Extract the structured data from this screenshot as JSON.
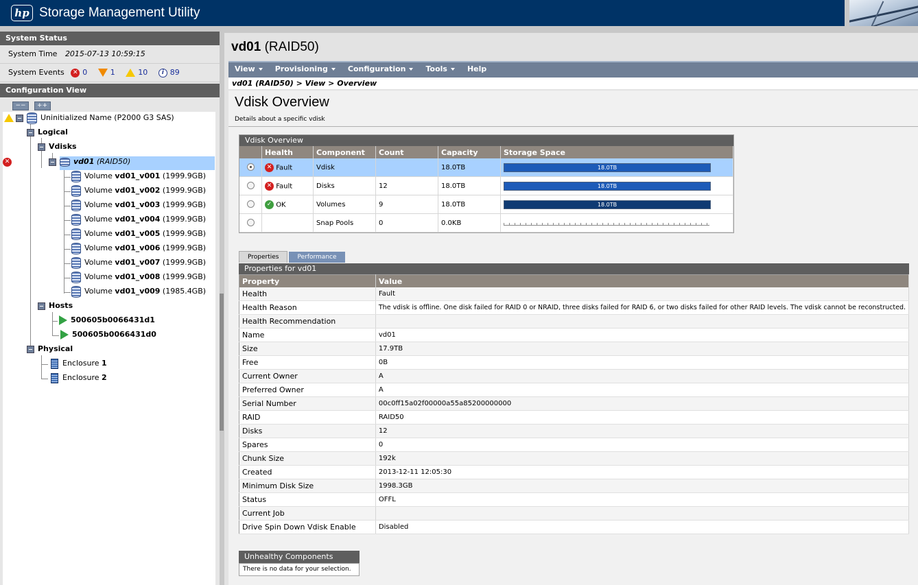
{
  "app": {
    "title": "Storage Management Utility",
    "logo": "hp"
  },
  "left": {
    "system_status_title": "System Status",
    "system_time_label": "System Time",
    "system_time_value": "2015-07-13 10:59:15",
    "system_events_label": "System Events",
    "events": {
      "critical": "0",
      "error": "1",
      "warning": "10",
      "info": "89"
    },
    "config_view_title": "Configuration View",
    "collapse_label": "−−",
    "expand_label": "++",
    "tree": {
      "root": "Uninitialized Name (P2000 G3 SAS)",
      "logical": "Logical",
      "vdisks": "Vdisks",
      "vdisk_name": "vd01",
      "vdisk_raid": "(RAID50)",
      "volume_prefix": "Volume",
      "volumes": [
        {
          "name": "vd01_v001",
          "size": "(1999.9GB)"
        },
        {
          "name": "vd01_v002",
          "size": "(1999.9GB)"
        },
        {
          "name": "vd01_v003",
          "size": "(1999.9GB)"
        },
        {
          "name": "vd01_v004",
          "size": "(1999.9GB)"
        },
        {
          "name": "vd01_v005",
          "size": "(1999.9GB)"
        },
        {
          "name": "vd01_v006",
          "size": "(1999.9GB)"
        },
        {
          "name": "vd01_v007",
          "size": "(1999.9GB)"
        },
        {
          "name": "vd01_v008",
          "size": "(1999.9GB)"
        },
        {
          "name": "vd01_v009",
          "size": "(1985.4GB)"
        }
      ],
      "hosts": "Hosts",
      "host_items": [
        "500605b0066431d1",
        "500605b0066431d0"
      ],
      "physical": "Physical",
      "enclosure_label": "Enclosure",
      "enclosures": [
        "1",
        "2"
      ]
    }
  },
  "main": {
    "title_name": "vd01",
    "title_raid": "(RAID50)",
    "menu": [
      "View",
      "Provisioning",
      "Configuration",
      "Tools",
      "Help"
    ],
    "breadcrumb": "vd01 (RAID50) > View > Overview",
    "heading": "Vdisk Overview",
    "subheading": "Details about a specific vdisk",
    "overview": {
      "title": "Vdisk Overview",
      "columns": [
        "Health",
        "Component",
        "Count",
        "Capacity",
        "Storage Space"
      ],
      "rows": [
        {
          "health": "Fault",
          "component": "Vdisk",
          "count": "",
          "capacity": "18.0TB",
          "bar": "18.0TB"
        },
        {
          "health": "Fault",
          "component": "Disks",
          "count": "12",
          "capacity": "18.0TB",
          "bar": "18.0TB"
        },
        {
          "health": "OK",
          "component": "Volumes",
          "count": "9",
          "capacity": "18.0TB",
          "bar": "18.0TB"
        },
        {
          "health": "",
          "component": "Snap Pools",
          "count": "0",
          "capacity": "0.0KB",
          "bar": ""
        }
      ]
    },
    "tabs": [
      "Properties",
      "Performance"
    ],
    "properties": {
      "title": "Properties for vd01",
      "columns": [
        "Property",
        "Value"
      ],
      "rows": [
        [
          "Health",
          "Fault"
        ],
        [
          "Health Reason",
          "The vdisk is offline. One disk failed for RAID 0 or NRAID, three disks failed for RAID 6, or two disks failed for other RAID levels. The vdisk cannot be reconstructed."
        ],
        [
          "Health Recommendation",
          ""
        ],
        [
          "Name",
          "vd01"
        ],
        [
          "Size",
          "17.9TB"
        ],
        [
          "Free",
          "0B"
        ],
        [
          "Current Owner",
          "A"
        ],
        [
          "Preferred Owner",
          "A"
        ],
        [
          "Serial Number",
          "00c0ff15a02f00000a55a85200000000"
        ],
        [
          "RAID",
          "RAID50"
        ],
        [
          "Disks",
          "12"
        ],
        [
          "Spares",
          "0"
        ],
        [
          "Chunk Size",
          "192k"
        ],
        [
          "Created",
          "2013-12-11 12:05:30"
        ],
        [
          "Minimum Disk Size",
          "1998.3GB"
        ],
        [
          "Status",
          "OFFL"
        ],
        [
          "Current Job",
          ""
        ],
        [
          "Drive Spin Down Vdisk Enable",
          "Disabled"
        ]
      ]
    },
    "unhealthy": {
      "title": "Unhealthy Components",
      "message": "There is no data for your selection."
    }
  }
}
